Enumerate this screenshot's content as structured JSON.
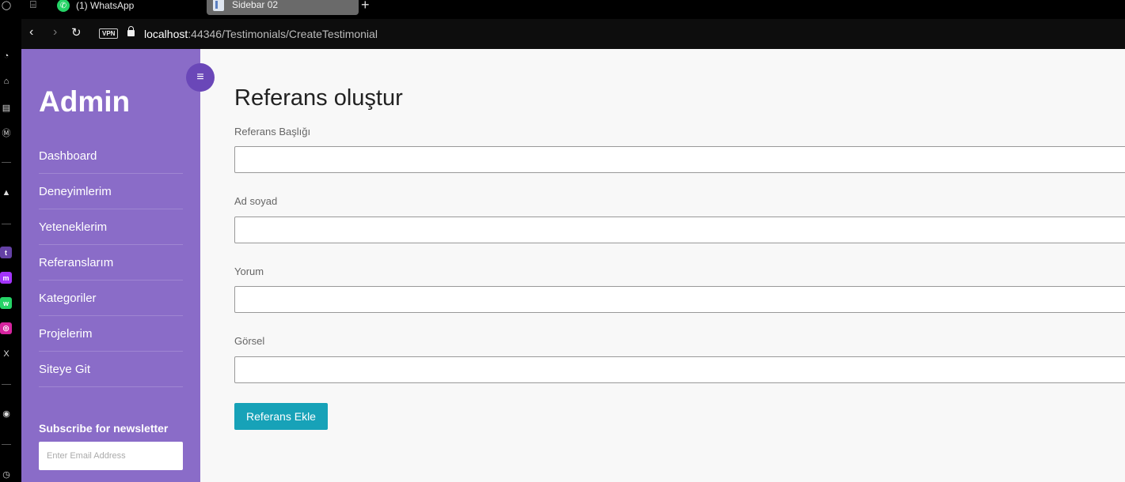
{
  "browser": {
    "tabs": [
      {
        "label": "(1) WhatsApp"
      },
      {
        "label": "Sidebar 02"
      }
    ],
    "vpn_badge": "VPN",
    "url_host": "localhost",
    "url_rest": ":44346/Testimonials/CreateTestimonial"
  },
  "sidebar": {
    "brand": "Admin",
    "toggle_icon": "menu-icon",
    "items": [
      {
        "label": "Dashboard"
      },
      {
        "label": "Deneyimlerim"
      },
      {
        "label": "Yeteneklerim"
      },
      {
        "label": "Referanslarım"
      },
      {
        "label": "Kategoriler"
      },
      {
        "label": "Projelerim"
      },
      {
        "label": "Siteye Git"
      }
    ],
    "newsletter_title": "Subscribe for newsletter",
    "newsletter_placeholder": "Enter Email Address"
  },
  "form": {
    "title": "Referans oluştur",
    "fields": [
      {
        "label": "Referans Başlığı",
        "value": ""
      },
      {
        "label": "Ad soyad",
        "value": ""
      },
      {
        "label": "Yorum",
        "value": ""
      },
      {
        "label": "Görsel",
        "value": ""
      }
    ],
    "submit_label": "Referans Ekle"
  },
  "colors": {
    "sidebar_bg": "#8a6cc8",
    "toggle_bg": "#6a47b8",
    "button_bg": "#17a2b8",
    "page_bg": "#f8f8f8"
  }
}
